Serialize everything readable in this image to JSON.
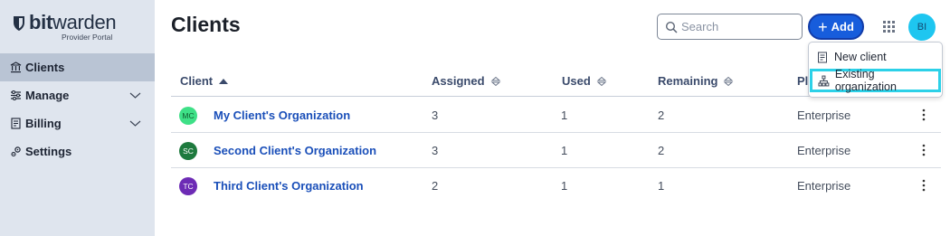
{
  "brand": {
    "name_bold": "bit",
    "name_regular": "warden",
    "subtitle": "Provider Portal"
  },
  "sidebar": {
    "items": [
      {
        "label": "Clients",
        "icon": "bank-icon",
        "active": true
      },
      {
        "label": "Manage",
        "icon": "sliders-icon",
        "expandable": true
      },
      {
        "label": "Billing",
        "icon": "billing-icon",
        "expandable": true
      },
      {
        "label": "Settings",
        "icon": "gears-icon"
      }
    ]
  },
  "header": {
    "title": "Clients",
    "search_placeholder": "Search",
    "add_label": "Add",
    "avatar_initials": "BI"
  },
  "menu": {
    "items": [
      {
        "label": "New client",
        "icon": "new-client-icon"
      },
      {
        "label": "Existing organization",
        "icon": "sitemap-icon",
        "focused": true
      }
    ]
  },
  "table": {
    "columns": [
      "Client",
      "Assigned",
      "Used",
      "Remaining",
      "Pl"
    ],
    "rows": [
      {
        "initials": "MC",
        "avatar_color": "#3ee087",
        "avatar_text_color": "#0f5a2e",
        "name": "My Client's Organization",
        "assigned": "3",
        "used": "1",
        "remaining": "2",
        "plan": "Enterprise"
      },
      {
        "initials": "SC",
        "avatar_color": "#1e7a3e",
        "avatar_text_color": "#ffffff",
        "name": "Second Client's Organization",
        "assigned": "3",
        "used": "1",
        "remaining": "2",
        "plan": "Enterprise"
      },
      {
        "initials": "TC",
        "avatar_color": "#6d2bb5",
        "avatar_text_color": "#ffffff",
        "name": "Third Client's Organization",
        "assigned": "2",
        "used": "1",
        "remaining": "1",
        "plan": "Enterprise"
      }
    ]
  },
  "colors": {
    "accent": "#175ddc",
    "focus_ring": "#2cd1e8",
    "sidebar_bg": "#dfe5ee",
    "sidebar_active": "#b9c4d4"
  }
}
